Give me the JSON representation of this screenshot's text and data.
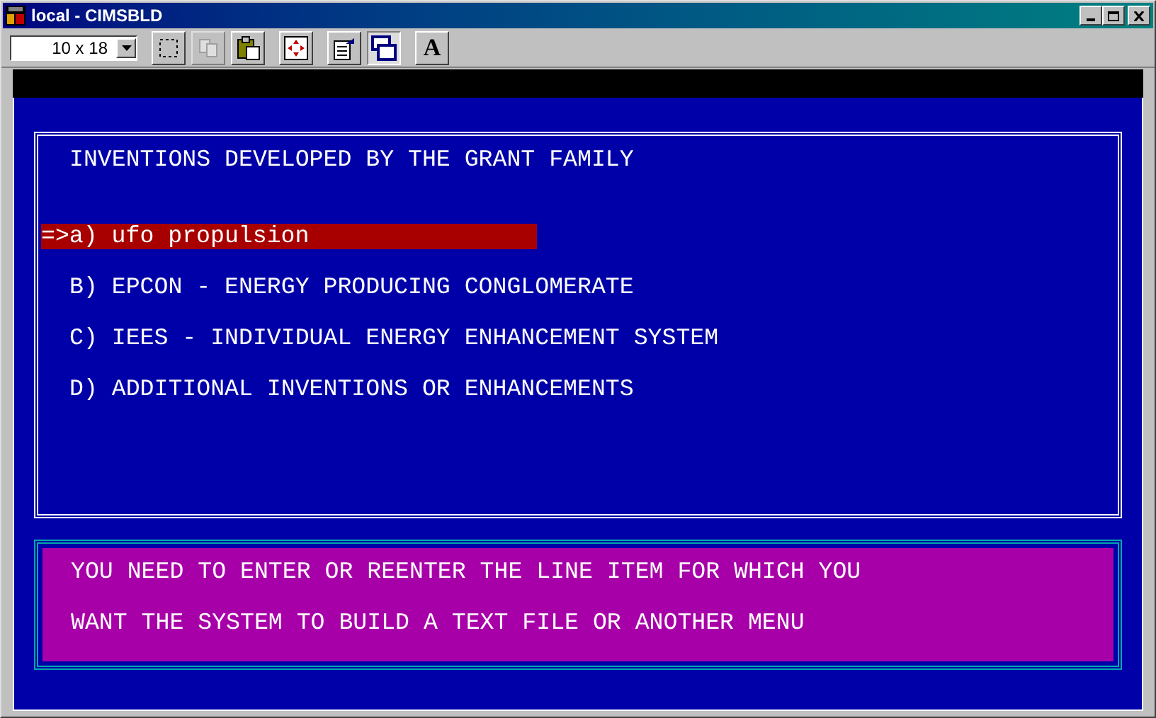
{
  "window": {
    "title": "local - CIMSBLD"
  },
  "toolbar": {
    "font_size": "10 x 18",
    "tools": [
      {
        "kind": "mark",
        "disabled": false,
        "selected": false
      },
      {
        "kind": "copy",
        "disabled": true,
        "selected": false
      },
      {
        "kind": "paste",
        "disabled": false,
        "selected": false
      },
      {
        "kind": "fullscreen",
        "disabled": false,
        "selected": false
      },
      {
        "kind": "properties",
        "disabled": false,
        "selected": false
      },
      {
        "kind": "background",
        "disabled": false,
        "selected": true
      },
      {
        "kind": "font",
        "label": "A",
        "disabled": false,
        "selected": false
      }
    ]
  },
  "menu": {
    "title": "INVENTIONS DEVELOPED BY THE GRANT FAMILY",
    "cursor": "=>",
    "items": [
      {
        "label": "a) ufo propulsion",
        "selected": true
      },
      {
        "label": "B) EPCON - ENERGY PRODUCING CONGLOMERATE",
        "selected": false
      },
      {
        "label": "C) IEES - INDIVIDUAL ENERGY ENHANCEMENT SYSTEM",
        "selected": false
      },
      {
        "label": "D) ADDITIONAL INVENTIONS OR ENHANCEMENTS",
        "selected": false
      }
    ]
  },
  "message": [
    "YOU NEED TO ENTER OR REENTER THE LINE ITEM FOR WHICH YOU",
    "WANT THE SYSTEM TO BUILD A TEXT FILE OR ANOTHER MENU"
  ]
}
